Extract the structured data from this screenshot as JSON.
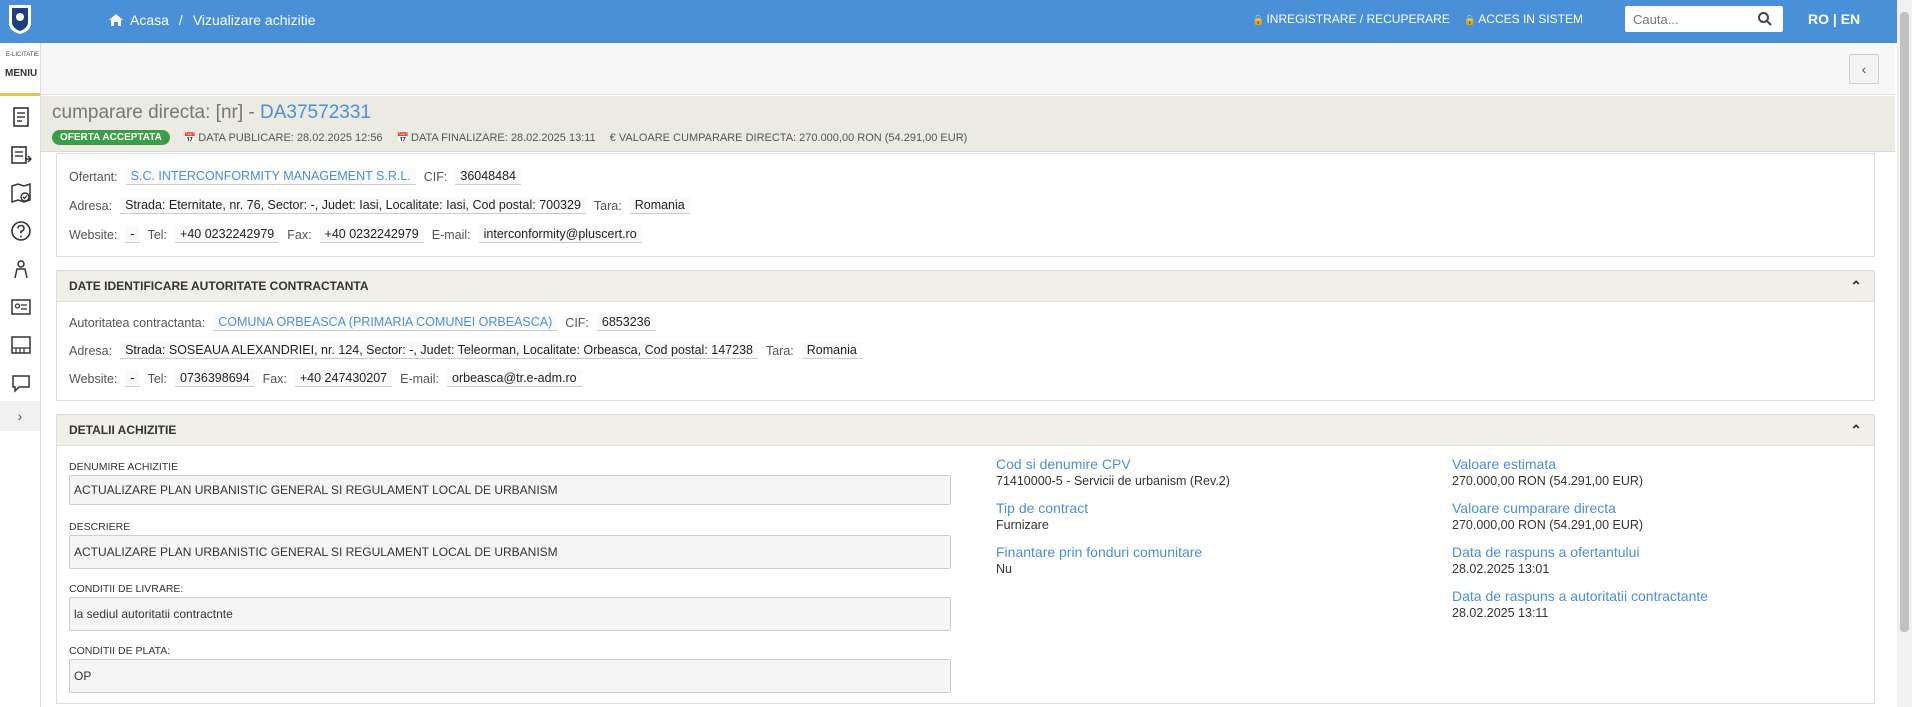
{
  "header": {
    "breadcrumb_home": "Acasa",
    "breadcrumb_separator": "/",
    "breadcrumb_current": "Vizualizare achizitie",
    "register_link": "INREGISTRARE / RECUPERARE",
    "login_link": "ACCES IN SISTEM",
    "search_placeholder": "Cauta...",
    "lang": "RO | EN"
  },
  "sidebar": {
    "brand": "E-LICITATIE",
    "menu_label": "MENIU",
    "items": [
      "document-icon",
      "list-arrow-icon",
      "map-check-icon",
      "help-icon",
      "user-icon",
      "id-card-icon",
      "catalog-icon",
      "chat-icon"
    ],
    "expand": "›"
  },
  "collapse_symbol": "‹",
  "title": {
    "prefix": "cumparare directa: [nr] - ",
    "code": "DA37572331",
    "status_badge": "OFERTA ACCEPTATA",
    "date_published": "DATA PUBLICARE: 28.02.2025 12:56",
    "date_finalized": "DATA FINALIZARE: 28.02.2025 13:11",
    "value": "€ VALOARE CUMPARARE DIRECTA: 270.000,00  RON (54.291,00  EUR)"
  },
  "ofertant": {
    "label": "Ofertant:",
    "name": "S.C. INTERCONFORMITY MANAGEMENT S.R.L.",
    "cif_label": "CIF:",
    "cif": "36048484",
    "address_label": "Adresa:",
    "address": "Strada: Eternitate, nr. 76, Sector: -, Judet: Iasi, Localitate: Iasi, Cod postal: 700329",
    "country_label": "Tara:",
    "country": "Romania",
    "website_label": "Website:",
    "website": "-",
    "tel_label": "Tel:",
    "tel": "+40 0232242979",
    "fax_label": "Fax:",
    "fax": "+40 0232242979",
    "email_label": "E-mail:",
    "email": "interconformity@pluscert.ro"
  },
  "autoritate": {
    "header": "DATE IDENTIFICARE AUTORITATE CONTRACTANTA",
    "label": "Autoritatea contractanta:",
    "name": "COMUNA ORBEASCA (PRIMARIA COMUNEI ORBEASCA)",
    "cif_label": "CIF:",
    "cif": "6853236",
    "address_label": "Adresa:",
    "address": "Strada: SOSEAUA ALEXANDRIEI, nr. 124, Sector: -, Judet: Teleorman, Localitate: Orbeasca, Cod postal: 147238",
    "country_label": "Tara:",
    "country": "Romania",
    "website_label": "Website:",
    "website": "-",
    "tel_label": "Tel:",
    "tel": "0736398694",
    "fax_label": "Fax:",
    "fax": "+40 247430207",
    "email_label": "E-mail:",
    "email": "orbeasca@tr.e-adm.ro"
  },
  "detalii": {
    "header": "DETALII ACHIZITIE",
    "denumire_label": "DENUMIRE ACHIZITIE",
    "denumire": "ACTUALIZARE PLAN URBANISTIC GENERAL SI REGULAMENT LOCAL DE URBANISM",
    "descriere_label": "DESCRIERE",
    "descriere": "ACTUALIZARE PLAN URBANISTIC GENERAL SI REGULAMENT LOCAL DE URBANISM",
    "livrare_label": "CONDITII DE LIVRARE:",
    "livrare": "la sediul autoritatii contractnte",
    "plata_label": "CONDITII DE PLATA:",
    "plata": "OP",
    "cpv_label": "Cod si denumire CPV",
    "cpv": "71410000-5 - Servicii de urbanism (Rev.2)",
    "tip_label": "Tip de contract",
    "tip": "Furnizare",
    "fonduri_label": "Finantare prin fonduri comunitare",
    "fonduri": "Nu",
    "estimata_label": "Valoare estimata",
    "estimata": "270.000,00  RON (54.291,00  EUR)",
    "cumparare_label": "Valoare cumparare directa",
    "cumparare": "270.000,00  RON (54.291,00  EUR)",
    "raspuns_ofertant_label": "Data de raspuns a ofertantului",
    "raspuns_ofertant": "28.02.2025 13:01",
    "raspuns_autoritate_label": "Data de raspuns a autoritatii contractante",
    "raspuns_autoritate": "28.02.2025 13:11"
  }
}
